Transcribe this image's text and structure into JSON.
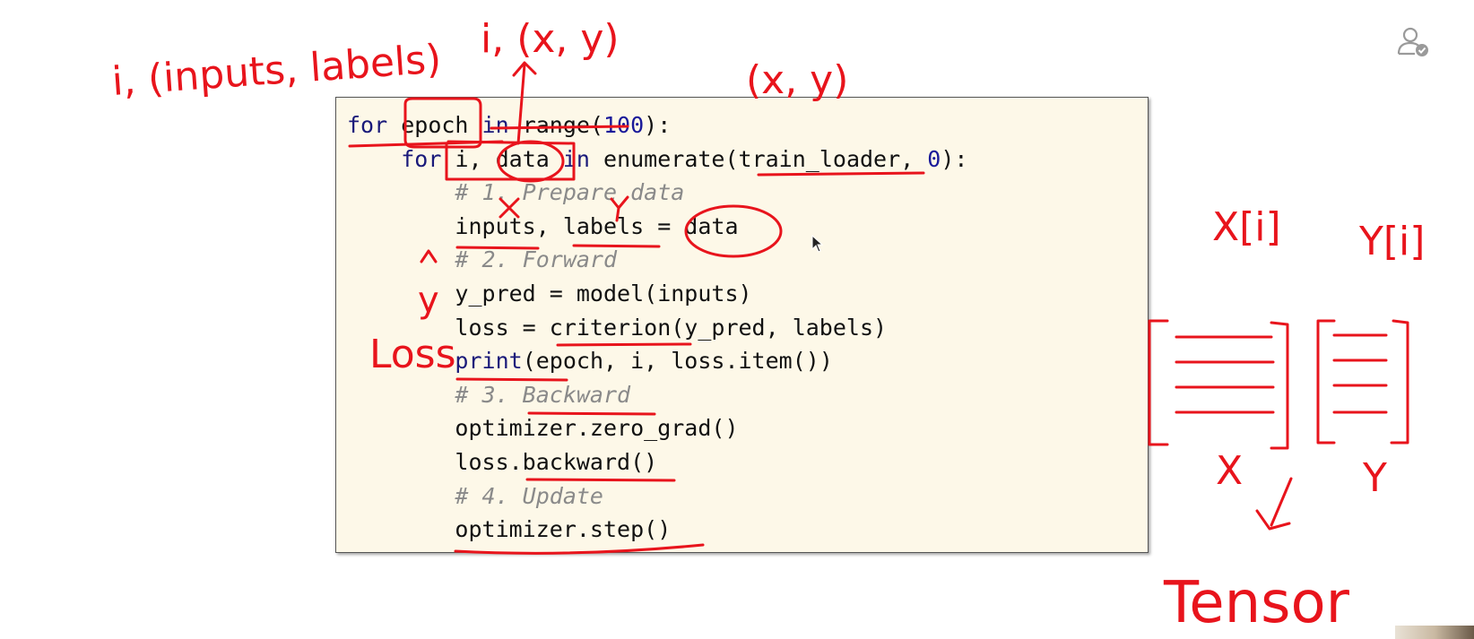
{
  "code": {
    "lines": [
      {
        "indent": "",
        "parts": [
          {
            "cls": "kw",
            "text": "for "
          },
          {
            "cls": "",
            "text": "epoch "
          },
          {
            "cls": "kw",
            "text": "in "
          },
          {
            "cls": "",
            "text": "range("
          },
          {
            "cls": "num",
            "text": "100"
          },
          {
            "cls": "",
            "text": "):"
          }
        ]
      },
      {
        "indent": "    ",
        "parts": [
          {
            "cls": "kw",
            "text": "for "
          },
          {
            "cls": "",
            "text": "i, data "
          },
          {
            "cls": "kw",
            "text": "in "
          },
          {
            "cls": "",
            "text": "enumerate(train_loader, "
          },
          {
            "cls": "num",
            "text": "0"
          },
          {
            "cls": "",
            "text": "):"
          }
        ]
      },
      {
        "indent": "        ",
        "parts": [
          {
            "cls": "cmt",
            "text": "# 1. Prepare data"
          }
        ]
      },
      {
        "indent": "        ",
        "parts": [
          {
            "cls": "",
            "text": "inputs, labels = data"
          }
        ]
      },
      {
        "indent": "        ",
        "parts": [
          {
            "cls": "cmt",
            "text": "# 2. Forward"
          }
        ]
      },
      {
        "indent": "        ",
        "parts": [
          {
            "cls": "",
            "text": "y_pred = model(inputs)"
          }
        ]
      },
      {
        "indent": "        ",
        "parts": [
          {
            "cls": "",
            "text": "loss = criterion(y_pred, labels)"
          }
        ]
      },
      {
        "indent": "        ",
        "parts": [
          {
            "cls": "fn-blue",
            "text": "print"
          },
          {
            "cls": "",
            "text": "(epoch, i, loss.item())"
          }
        ]
      },
      {
        "indent": "        ",
        "parts": [
          {
            "cls": "cmt",
            "text": "# 3. Backward"
          }
        ]
      },
      {
        "indent": "        ",
        "parts": [
          {
            "cls": "",
            "text": "optimizer.zero_grad()"
          }
        ]
      },
      {
        "indent": "        ",
        "parts": [
          {
            "cls": "",
            "text": "loss.backward()"
          }
        ]
      },
      {
        "indent": "        ",
        "parts": [
          {
            "cls": "cmt",
            "text": "# 4. Update"
          }
        ]
      },
      {
        "indent": "        ",
        "parts": [
          {
            "cls": "",
            "text": "optimizer.step()"
          }
        ]
      }
    ]
  },
  "annotations": {
    "top_left": "i, (inputs, labels)",
    "top_mid": "i, (x, y)",
    "top_right": "(x, y)",
    "x_mark": "x",
    "y_mark": "y",
    "y_hat": "ŷ",
    "loss": "Loss",
    "x_index": "X[i]",
    "y_index": "Y[i]",
    "matrix_x_label": "X",
    "matrix_y_label": "Y",
    "tensor": "Tensor"
  },
  "colors": {
    "ink": "#e8141c",
    "panel_bg": "#fdf8e8",
    "keyword": "#1a1a7a",
    "comment": "#8a8a8a"
  },
  "icons": {
    "account": "user-check-icon",
    "cursor": "mouse-pointer-icon"
  }
}
